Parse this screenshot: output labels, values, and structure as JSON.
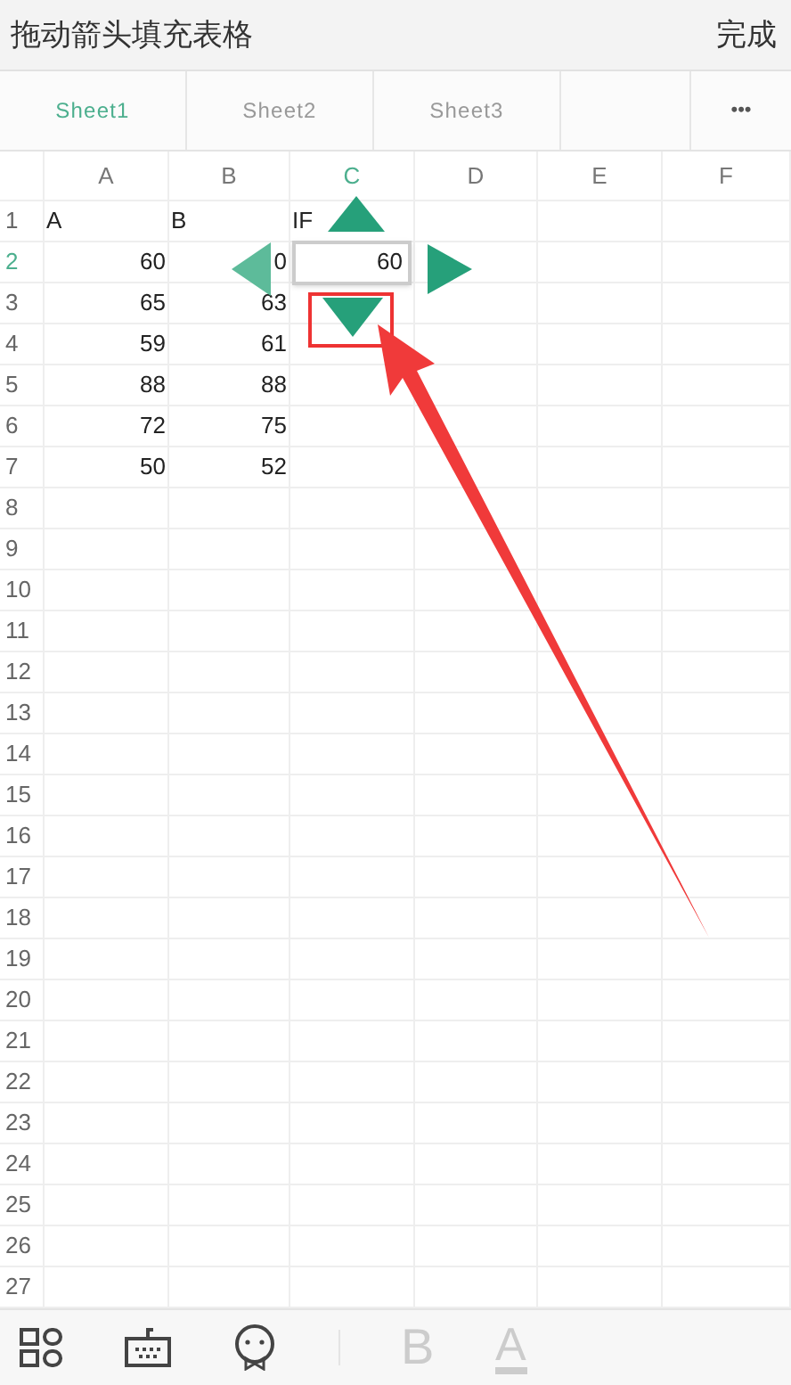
{
  "header": {
    "title": "拖动箭头填充表格",
    "done_button": "完成"
  },
  "tabs": [
    {
      "label": "Sheet1",
      "selected": true
    },
    {
      "label": "Sheet2",
      "selected": false
    },
    {
      "label": "Sheet3",
      "selected": false
    }
  ],
  "more_button": "•••",
  "columns": [
    {
      "label": "A",
      "selected": false
    },
    {
      "label": "B",
      "selected": false
    },
    {
      "label": "C",
      "selected": true
    },
    {
      "label": "D",
      "selected": false
    },
    {
      "label": "E",
      "selected": false
    },
    {
      "label": "F",
      "selected": false
    }
  ],
  "rows": [
    {
      "number": "1",
      "selected": false,
      "cells": [
        {
          "text": "A",
          "selected": false,
          "kind": "text"
        },
        {
          "text": "B",
          "selected": false,
          "kind": "text"
        },
        {
          "text": "IF",
          "selected": false,
          "kind": "text"
        }
      ]
    },
    {
      "number": "2",
      "selected": true,
      "cells": [
        {
          "text": "60",
          "selected": false,
          "kind": "number"
        },
        {
          "text": "0",
          "selected": false,
          "kind": "number"
        },
        {
          "text": "60",
          "selected": true,
          "kind": "number"
        }
      ]
    },
    {
      "number": "3",
      "selected": false,
      "cells": [
        {
          "text": "65",
          "selected": false,
          "kind": "number"
        },
        {
          "text": "63",
          "selected": false,
          "kind": "number"
        }
      ]
    },
    {
      "number": "4",
      "selected": false,
      "cells": [
        {
          "text": "59",
          "selected": false,
          "kind": "number"
        },
        {
          "text": "61",
          "selected": false,
          "kind": "number"
        }
      ]
    },
    {
      "number": "5",
      "selected": false,
      "cells": [
        {
          "text": "88",
          "selected": false,
          "kind": "number"
        },
        {
          "text": "88",
          "selected": false,
          "kind": "number"
        }
      ]
    },
    {
      "number": "6",
      "selected": false,
      "cells": [
        {
          "text": "72",
          "selected": false,
          "kind": "number"
        },
        {
          "text": "75",
          "selected": false,
          "kind": "number"
        }
      ]
    },
    {
      "number": "7",
      "selected": false,
      "cells": [
        {
          "text": "50",
          "selected": false,
          "kind": "number"
        },
        {
          "text": "52",
          "selected": false,
          "kind": "number"
        }
      ]
    },
    {
      "number": "8",
      "selected": false,
      "cells": []
    },
    {
      "number": "9",
      "selected": false,
      "cells": []
    },
    {
      "number": "10",
      "selected": false,
      "cells": []
    },
    {
      "number": "11",
      "selected": false,
      "cells": []
    },
    {
      "number": "12",
      "selected": false,
      "cells": []
    },
    {
      "number": "13",
      "selected": false,
      "cells": []
    },
    {
      "number": "14",
      "selected": false,
      "cells": []
    },
    {
      "number": "15",
      "selected": false,
      "cells": []
    },
    {
      "number": "16",
      "selected": false,
      "cells": []
    },
    {
      "number": "17",
      "selected": false,
      "cells": []
    },
    {
      "number": "18",
      "selected": false,
      "cells": []
    },
    {
      "number": "19",
      "selected": false,
      "cells": []
    },
    {
      "number": "20",
      "selected": false,
      "cells": []
    },
    {
      "number": "21",
      "selected": false,
      "cells": []
    },
    {
      "number": "22",
      "selected": false,
      "cells": []
    },
    {
      "number": "23",
      "selected": false,
      "cells": []
    },
    {
      "number": "24",
      "selected": false,
      "cells": []
    },
    {
      "number": "25",
      "selected": false,
      "cells": []
    },
    {
      "number": "26",
      "selected": false,
      "cells": []
    },
    {
      "number": "27",
      "selected": false,
      "cells": []
    }
  ],
  "tools": [
    {
      "kind": "grid"
    },
    {
      "kind": "keyboard"
    },
    {
      "kind": "face"
    }
  ],
  "format_tools": [
    {
      "kind": "bold",
      "label": "B",
      "disabled": true
    },
    {
      "kind": "color",
      "label": "A",
      "disabled": true
    }
  ]
}
